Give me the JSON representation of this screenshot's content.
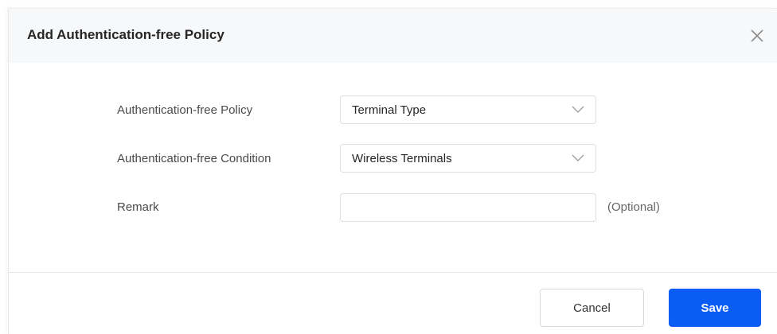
{
  "dialog": {
    "title": "Add Authentication-free Policy",
    "close_icon": "close-icon"
  },
  "form": {
    "policy": {
      "label": "Authentication-free Policy",
      "value": "Terminal Type"
    },
    "condition": {
      "label": "Authentication-free Condition",
      "value": "Wireless Terminals"
    },
    "remark": {
      "label": "Remark",
      "value": "",
      "placeholder": "",
      "hint": "(Optional)"
    }
  },
  "footer": {
    "cancel_label": "Cancel",
    "save_label": "Save"
  },
  "colors": {
    "header_bg": "#f7f8fa",
    "primary": "#0a5cf5",
    "border": "#dcdfe6"
  }
}
